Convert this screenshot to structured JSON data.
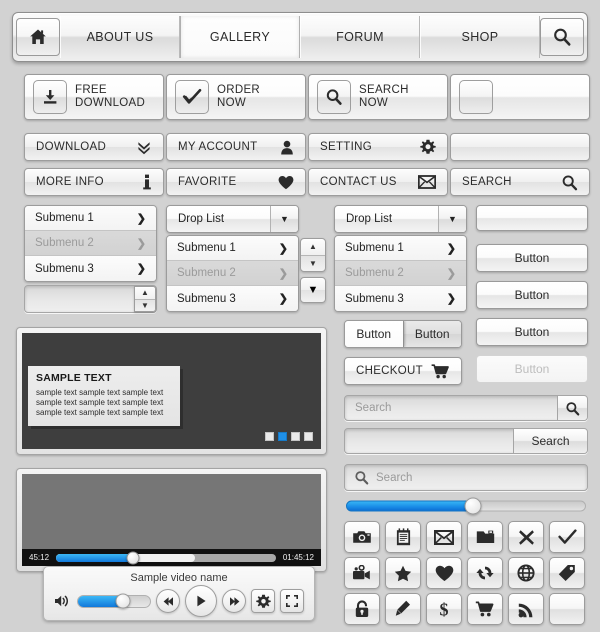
{
  "nav": {
    "home_icon": "home-icon",
    "search_icon": "search-icon",
    "items": [
      {
        "label": "ABOUT US",
        "active": false
      },
      {
        "label": "GALLERY",
        "active": true
      },
      {
        "label": "FORUM",
        "active": false
      },
      {
        "label": "SHOP",
        "active": false
      }
    ]
  },
  "big_buttons": [
    {
      "line1": "FREE",
      "line2": "DOWNLOAD",
      "icon": "download-icon"
    },
    {
      "line1": "ORDER",
      "line2": "NOW",
      "icon": "check-icon"
    },
    {
      "line1": "SEARCH",
      "line2": "NOW",
      "icon": "search-icon"
    },
    {
      "line1": "",
      "line2": "",
      "icon": "blank-icon"
    }
  ],
  "label_buttons_row1": [
    {
      "label": "DOWNLOAD",
      "icon": "double-chevron-down-icon"
    },
    {
      "label": "MY ACCOUNT",
      "icon": "user-icon"
    },
    {
      "label": "SETTING",
      "icon": "gear-icon"
    },
    {
      "label": "",
      "icon": "none"
    }
  ],
  "label_buttons_row2": [
    {
      "label": "MORE INFO",
      "icon": "info-icon"
    },
    {
      "label": "FAVORITE",
      "icon": "heart-icon"
    },
    {
      "label": "CONTACT US",
      "icon": "envelope-icon"
    },
    {
      "label": "SEARCH",
      "icon": "search-icon"
    }
  ],
  "submenu_plain": {
    "items": [
      {
        "label": "Submenu 1",
        "disabled": false
      },
      {
        "label": "Submenu 2",
        "disabled": true
      },
      {
        "label": "Submenu 3",
        "disabled": false
      }
    ],
    "arrow": "❯"
  },
  "droplist_a": {
    "title": "Drop List",
    "caret": "▼",
    "items": [
      {
        "label": "Submenu 1",
        "disabled": false
      },
      {
        "label": "Submenu 2",
        "disabled": true
      },
      {
        "label": "Submenu 3",
        "disabled": false
      }
    ]
  },
  "droplist_b": {
    "title": "Drop List",
    "caret": "▼",
    "items": [
      {
        "label": "Submenu 1",
        "disabled": false
      },
      {
        "label": "Submenu 2",
        "disabled": true
      },
      {
        "label": "Submenu 3",
        "disabled": false
      }
    ]
  },
  "spinners": {
    "up": "▲",
    "down": "▼"
  },
  "buttons_right": [
    {
      "label": "Button",
      "disabled": false
    },
    {
      "label": "Button",
      "disabled": false
    },
    {
      "label": "Button",
      "disabled": false
    },
    {
      "label": "Button",
      "disabled": true
    }
  ],
  "segmented": {
    "left": "Button",
    "right": "Button"
  },
  "checkout": {
    "label": "CHECKOUT",
    "icon": "cart-icon"
  },
  "search_fields": {
    "field_a": {
      "placeholder": "Search",
      "value": "Search",
      "icon": "search-icon"
    },
    "field_b": {
      "value": "",
      "button_label": "Search"
    },
    "field_c": {
      "value": "Search",
      "icon": "search-icon"
    }
  },
  "slider": {
    "value_percent": 53,
    "fill_color": "#1b8fe8"
  },
  "icon_grid": [
    "camera-icon",
    "clipboard-icon",
    "envelope-icon",
    "folder-icon",
    "close-x-icon",
    "check-icon",
    "video-camera-icon",
    "star-icon",
    "heart-icon",
    "refresh-icon",
    "globe-icon",
    "tag-icon",
    "lock-icon",
    "pencil-icon",
    "dollar-icon",
    "cart-icon",
    "rss-icon",
    "blank-icon"
  ],
  "content_panel": {
    "caption_title": "SAMPLE TEXT",
    "caption_lines": [
      "sample text sample text sample text",
      "sample text sample text sample text",
      "sample text sample text sample text"
    ],
    "dots": [
      {
        "active": false
      },
      {
        "active": true
      },
      {
        "active": false
      },
      {
        "active": false
      }
    ]
  },
  "video": {
    "current_time": "45:12",
    "total_time": "01:45:12",
    "progress_percent": 35,
    "buffer_percent": 63,
    "title": "Sample video name",
    "volume_percent": 62,
    "controls": {
      "volume_icon": "volume-icon",
      "prev_icon": "rewind-icon",
      "play_icon": "play-icon",
      "next_icon": "fastforward-icon",
      "settings_icon": "gear-icon",
      "fullscreen_icon": "fullscreen-icon"
    }
  }
}
